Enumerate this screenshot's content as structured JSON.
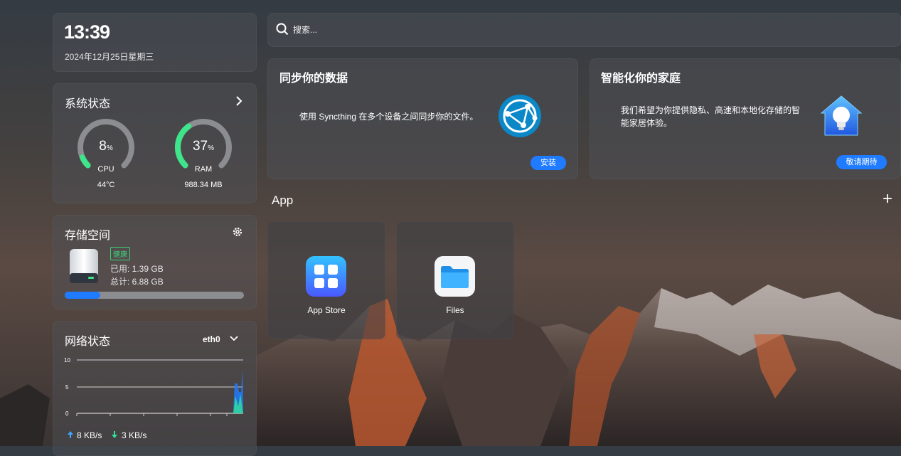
{
  "clock": {
    "time": "13:39",
    "date": "2024年12月25日星期三"
  },
  "system": {
    "title": "系统状态",
    "cpu": {
      "percent": 8,
      "unit": "%",
      "label": "CPU",
      "temp": "44°C"
    },
    "ram": {
      "percent": 37,
      "unit": "%",
      "label": "RAM",
      "used": "988.34 MB"
    }
  },
  "storage": {
    "title": "存储空间",
    "badge": "健康",
    "used": "已用: 1.39 GB",
    "total": "总计: 6.88 GB",
    "fraction": 0.2
  },
  "network": {
    "title": "网络状态",
    "interface": "eth0",
    "y_ticks": [
      "10",
      "5",
      "0"
    ],
    "upload": "8 KB/s",
    "download": "3 KB/s"
  },
  "search": {
    "placeholder": "搜索..."
  },
  "promos": [
    {
      "title": "同步你的数据",
      "desc": "使用 Syncthing 在多个设备之间同步你的文件。",
      "button": "安装"
    },
    {
      "title": "智能化你的家庭",
      "desc_line1": "我们希望为你提供隐私、高速和本地化存储的智",
      "desc_line2": "能家居体验。",
      "button": "敬请期待"
    }
  ],
  "apps_section": {
    "title": "App",
    "add": "+"
  },
  "apps": [
    {
      "name": "App Store",
      "icon": "app-store-icon"
    },
    {
      "name": "Files",
      "icon": "folder-icon"
    }
  ],
  "colors": {
    "accent": "#1f7bff",
    "gauge_green": "#3ee58a",
    "gauge_track": "#8b8d90",
    "healthy": "#3ad07a"
  }
}
